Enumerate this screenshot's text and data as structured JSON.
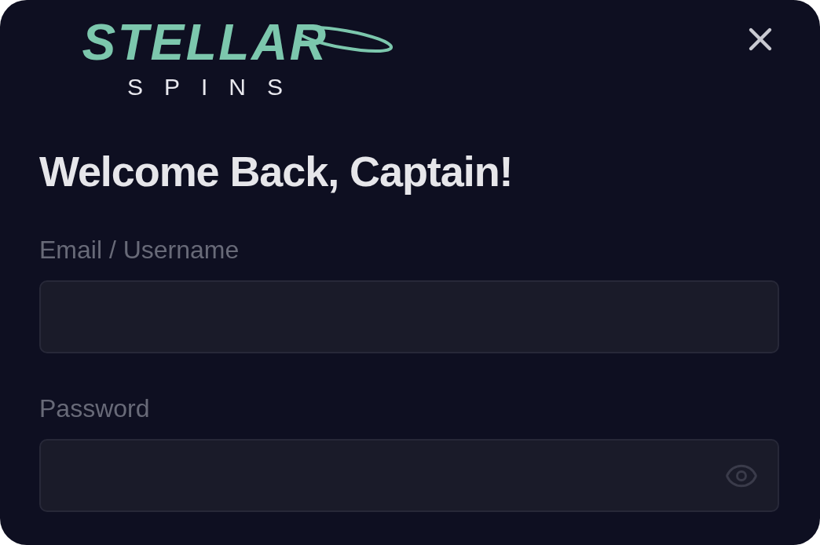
{
  "logo": {
    "wordmark": "STELLAR",
    "tagline": "SPINS"
  },
  "heading": "Welcome Back, Captain!",
  "fields": [
    {
      "kind": "text",
      "label": "Email / Username"
    },
    {
      "kind": "password",
      "label": "Password"
    }
  ]
}
